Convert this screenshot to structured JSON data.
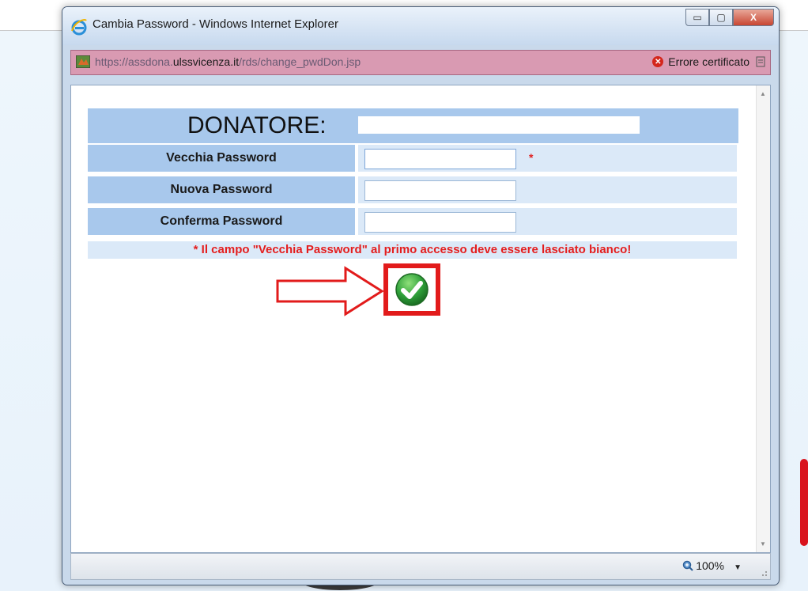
{
  "window": {
    "title": "Cambia Password - Windows Internet Explorer",
    "minimize_label": "▭",
    "maximize_label": "▢",
    "close_label": "X"
  },
  "address_bar": {
    "url_prefix": "https://assdona.",
    "url_domain": "ulssvicenza.it",
    "url_path": "/rds/change_pwdDon.jsp",
    "certificate_error": "Errore certificato"
  },
  "form": {
    "header_label": "DONATORE:",
    "donor_value": "",
    "old_password_label": "Vecchia Password",
    "new_password_label": "Nuova Password",
    "confirm_password_label": "Conferma Password",
    "required_marker": "*",
    "note": "* Il campo \"Vecchia Password\" al primo accesso deve essere lasciato bianco!"
  },
  "status_bar": {
    "zoom": "100%"
  },
  "colors": {
    "header_bg": "#a8c8ec",
    "row_bg": "#dbe9f8",
    "note_red": "#e41d1d",
    "highlight_red": "#e21b1b",
    "confirm_green": "#2fa13a"
  }
}
